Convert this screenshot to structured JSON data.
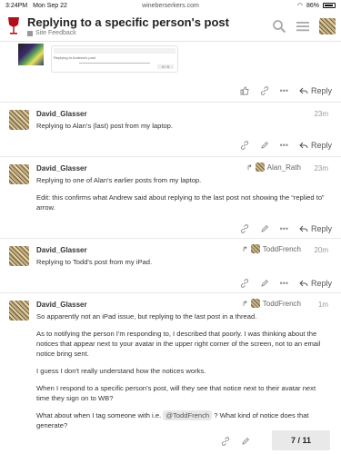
{
  "status": {
    "time": "3:24PM",
    "date": "Mon Sep 22",
    "url": "wineberserkers.com",
    "battery": "86%"
  },
  "header": {
    "title": "Replying to a specific person's post",
    "category": "Site Feedback"
  },
  "embedded_card": {
    "caption": "Replying to Andrew's post",
    "counter": "5 / 5"
  },
  "action_labels": {
    "reply": "Reply"
  },
  "posts": [
    {
      "user": "David_Glasser",
      "time": "23m",
      "text": [
        "Replying to Alan's (last) post from my laptop."
      ]
    },
    {
      "user": "David_Glasser",
      "time": "23m",
      "reply_to": "Alan_Rath",
      "text": [
        "Replying to one of Alan's earlier posts from my laptop.",
        "Edit: this confirms what Andrew said about replying to the last post not showing the “replied to” arrow."
      ]
    },
    {
      "user": "David_Glasser",
      "time": "20m",
      "reply_to": "ToddFrench",
      "text": [
        "Replying to Todd's post from my iPad."
      ]
    },
    {
      "user": "David_Glasser",
      "time": "1m",
      "reply_to": "ToddFrench",
      "text": [
        "So apparently not an iPad issue, but replying to the last post in a thread.",
        "As to notifying the person I'm responding to, I described that poorly. I was thinking about the notices that appear next to your avatar in the upper right corner of the screen, not to an email notice bring sent.",
        "I guess I don't really understand how the notices works.",
        "When I respond to a specific person's post, will they see that notice next to their avatar next time they sign on to WB?"
      ],
      "mention_before": "What about when I tag someone with i.e.",
      "mention": "@ToddFrench",
      "mention_after": "? What kind of notice does that generate?"
    }
  ],
  "progress": "7 / 11"
}
